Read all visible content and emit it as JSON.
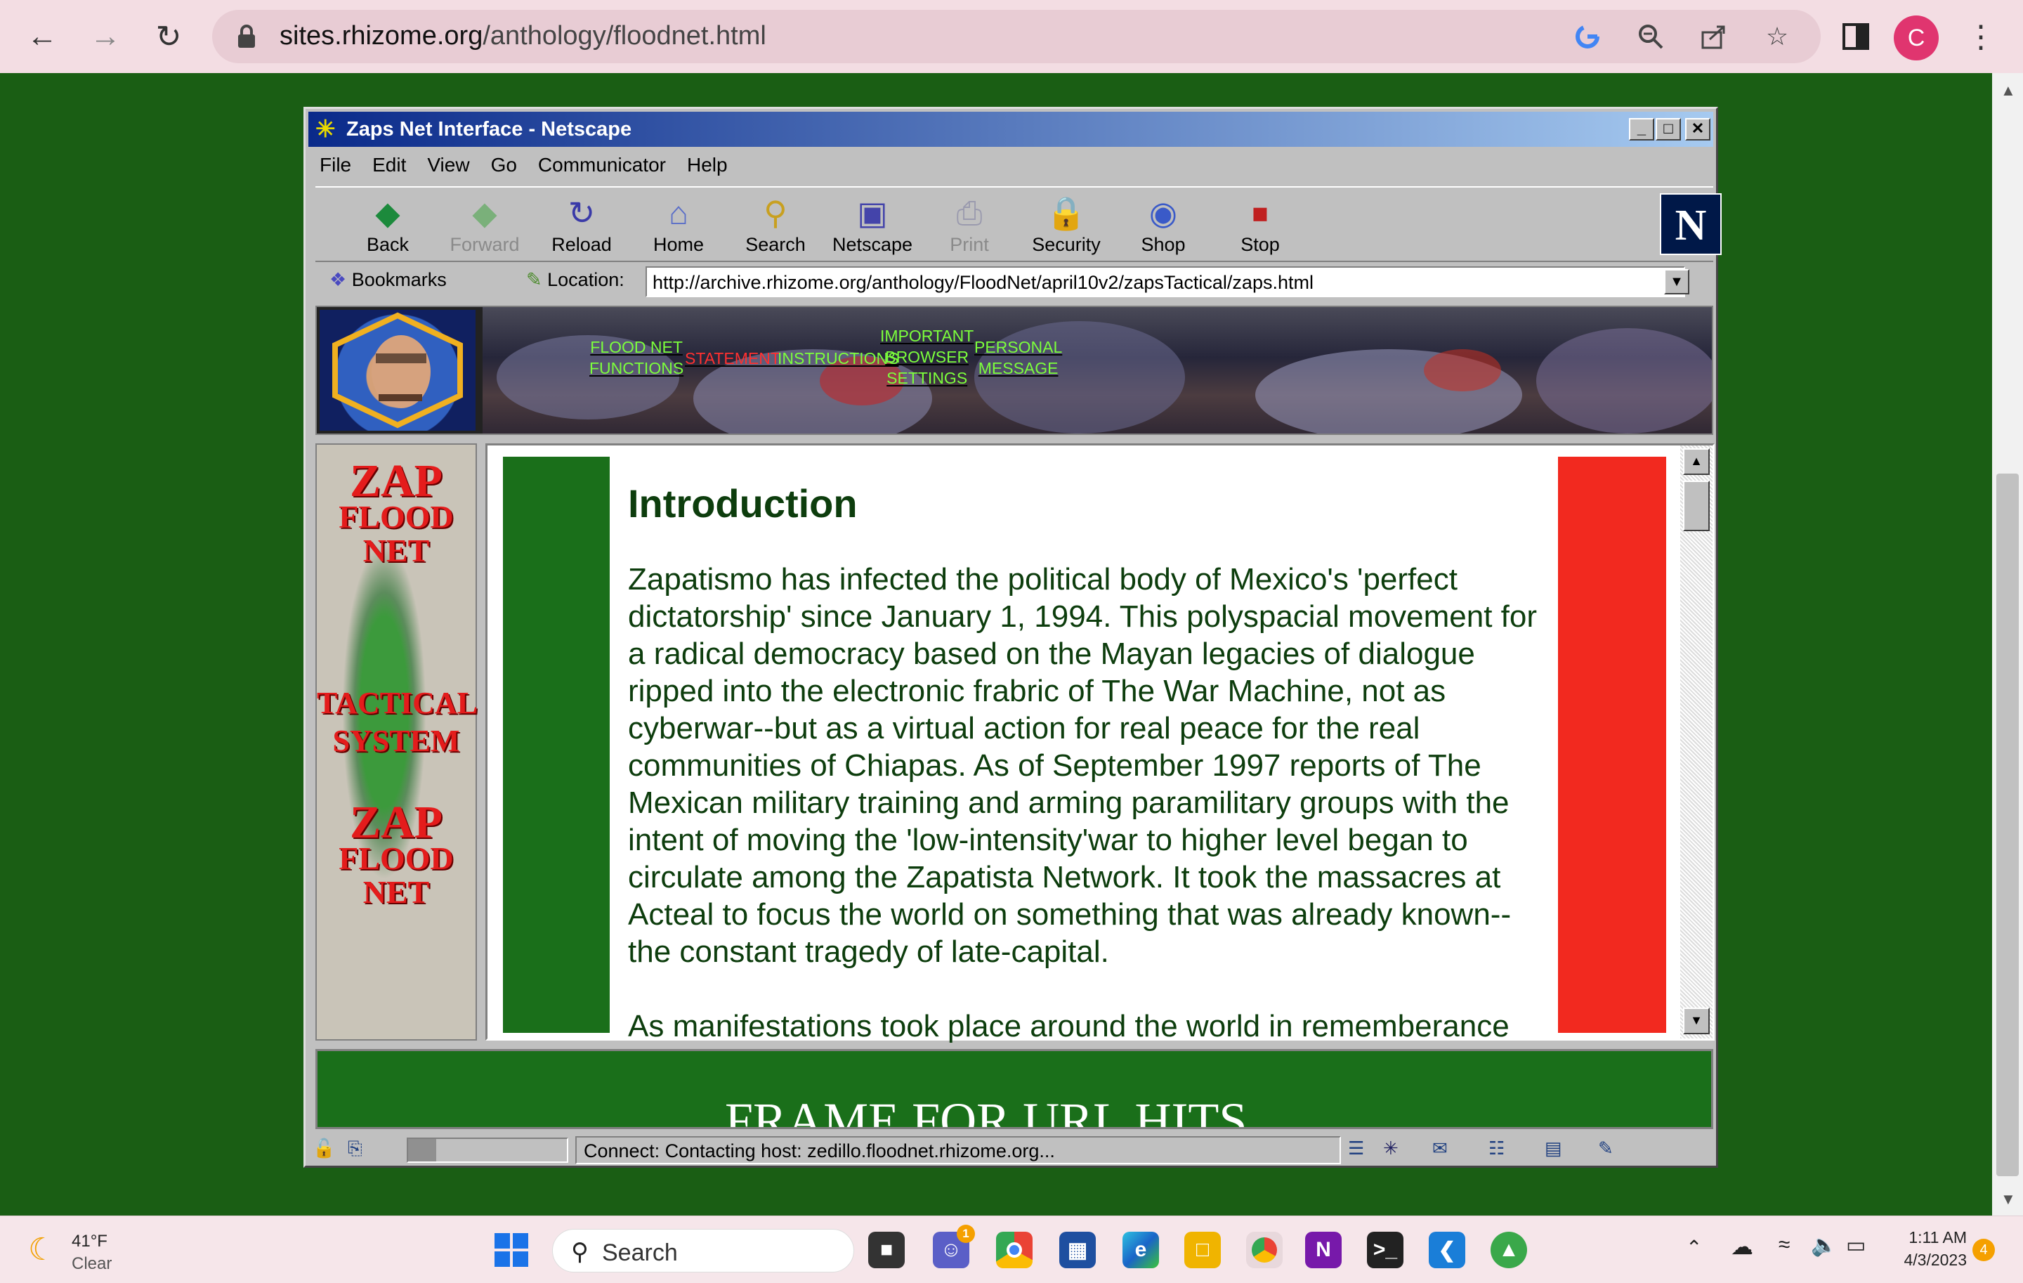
{
  "browser": {
    "url_host": "sites.rhizome.org",
    "url_path": "/anthology/floodnet.html",
    "profile_initial": "C"
  },
  "netscape": {
    "title": "Zaps Net Interface - Netscape",
    "menu": [
      "File",
      "Edit",
      "View",
      "Go",
      "Communicator",
      "Help"
    ],
    "toolbar": [
      "Back",
      "Forward",
      "Reload",
      "Home",
      "Search",
      "Netscape",
      "Print",
      "Security",
      "Shop",
      "Stop"
    ],
    "logo": "N",
    "bookmarks_label": "Bookmarks",
    "location_label": "Location:",
    "location_url": "http://archive.rhizome.org/anthology/FloodNet/april10v2/zapsTactical/zaps.html",
    "status_text": "Connect: Contacting host: zedillo.floodnet.rhizome.org..."
  },
  "banner_nav": [
    {
      "lines": [
        "FLOOD NET",
        "FUNCTIONS"
      ],
      "color": "#7cff3c"
    },
    {
      "lines": [
        "STATEMENT"
      ],
      "color": "#ff3030"
    },
    {
      "lines": [
        "INSTRUCTIONS"
      ],
      "color": "#7cff3c"
    },
    {
      "lines": [
        "IMPORTANT",
        "BROWSER",
        "SETTINGS"
      ],
      "color": "#7cff3c"
    },
    {
      "lines": [
        "PERSONAL",
        "MESSAGE"
      ],
      "color": "#7cff3c"
    }
  ],
  "left_frame": {
    "zap1": "ZAP",
    "flood1": "FLOOD",
    "net1": "NET",
    "tactical": "TACTICAL",
    "system": "SYSTEM",
    "zap2": "ZAP",
    "flood2": "FLOOD",
    "net2": "NET"
  },
  "content": {
    "title": "Introduction",
    "paragraph": "Zapatismo has infected the political body of Mexico's 'perfect dictatorship' since January 1, 1994. This polyspacial movement for a radical democracy based on the Mayan legacies of dialogue ripped into the electronic frabric of The War Machine, not as cyberwar--but as a virtual action for real peace for the real communities of Chiapas. As of September 1997 reports of The Mexican military training and arming paramilitary groups with the intent of moving the 'low-intensity'war to higher level began to circulate among the Zapatista Network. It took the massacres at Acteal to focus the world on something that was already known--the constant tragedy of late-capital.",
    "paragraph2": "As manifestations took place around the world in rememberance"
  },
  "bottom_frame_text": "FRAME FOR URL HITS",
  "taskbar": {
    "temp": "41°F",
    "condition": "Clear",
    "search_label": "Search",
    "time": "1:11 AM",
    "date": "4/3/2023",
    "notifications": "4",
    "teams_badge": "1"
  },
  "colors": {
    "page_bg": "#1a5e14",
    "green_band": "#1a6f1a",
    "red_band": "#f2291f",
    "text_green": "#0d3d0d"
  }
}
